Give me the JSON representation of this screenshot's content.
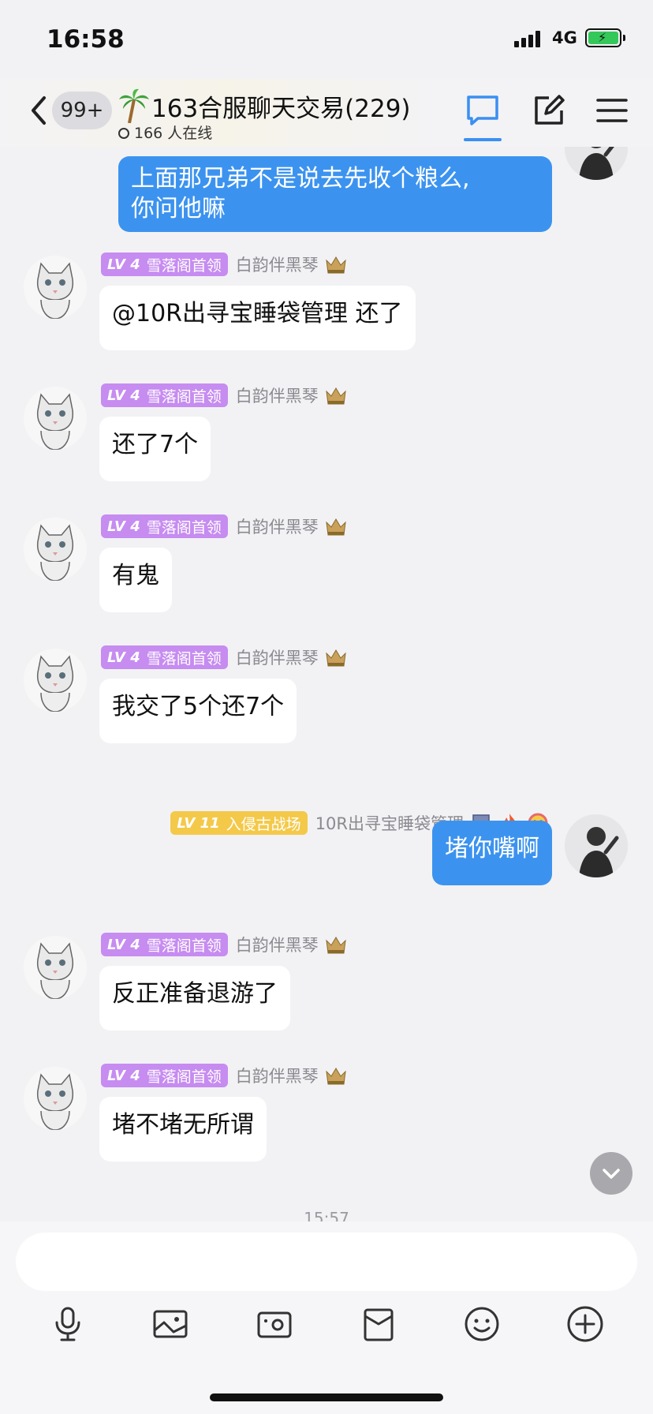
{
  "status": {
    "time": "16:58",
    "network": "4G"
  },
  "header": {
    "back_badge": "99+",
    "title": "163合服聊天交易(229)",
    "online": "166 人在线",
    "icons": [
      "chat-bubble-icon",
      "edit-icon",
      "menu-icon"
    ]
  },
  "messages": [
    {
      "mine": true,
      "text_line1": "上面那兄弟不是说去先收个粮么,",
      "text_line2": "你问他嘛"
    },
    {
      "level": "LV 4",
      "title": "雪落阁首领",
      "nick": "白韵伴黑琴",
      "text": "@10R出寻宝睡袋管理 还了"
    },
    {
      "level": "LV 4",
      "title": "雪落阁首领",
      "nick": "白韵伴黑琴",
      "text": "还了7个"
    },
    {
      "level": "LV 4",
      "title": "雪落阁首领",
      "nick": "白韵伴黑琴",
      "text": "有鬼"
    },
    {
      "level": "LV 4",
      "title": "雪落阁首领",
      "nick": "白韵伴黑琴",
      "text": "我交了5个还7个"
    },
    {
      "mine": true,
      "level": "LV 11",
      "title": "入侵古战场",
      "nick": "10R出寻宝睡袋管理",
      "text": "堵你嘴啊"
    },
    {
      "level": "LV 4",
      "title": "雪落阁首领",
      "nick": "白韵伴黑琴",
      "text": "反正准备退游了"
    },
    {
      "level": "LV 4",
      "title": "雪落阁首领",
      "nick": "白韵伴黑琴",
      "text": "堵不堵无所谓"
    }
  ],
  "timestamp": "15:57",
  "input": {
    "placeholder": ""
  },
  "toolbar": [
    "microphone-icon",
    "image-icon",
    "camera-icon",
    "red-packet-icon",
    "emoji-icon",
    "plus-icon"
  ],
  "colors": {
    "accent": "#3c93ef",
    "level_purple": "#c68cf0",
    "level_yellow": "#f4c94a",
    "battery": "#34c759"
  }
}
